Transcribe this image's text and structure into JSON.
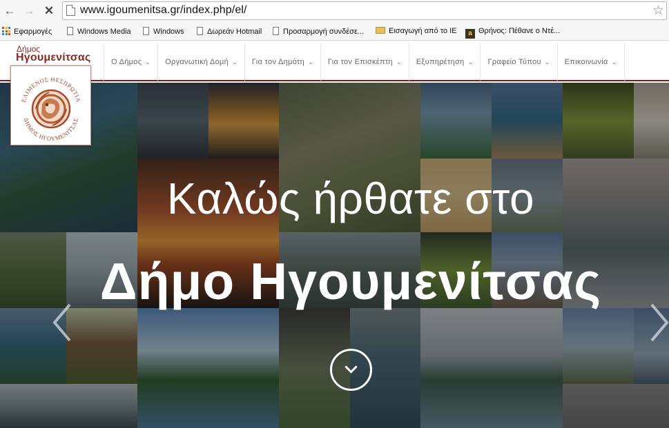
{
  "browser": {
    "url": "www.igoumenitsa.gr/index.php/el/",
    "bookmarks": [
      "Εφαρμογές",
      "Windows Media",
      "Windows",
      "Δωρεάν Hotmail",
      "Προσαρμογή συνδέσε...",
      "Εισαγωγή από το IE",
      "Θρήνος: Πέθανε ο Ντέ..."
    ],
    "bookmark_favicon_letter": "a"
  },
  "site": {
    "brand_small": "Δήμος",
    "brand_big": "Ηγουμενίτσας",
    "logo_text_top": "ΕΛΙΜΕΝΟΣ ΘΕΣΠΡΩΤΙΑ",
    "logo_text_bottom": "ΔΗΜΟΣ ΗΓΟΥΜΕΝΙΤΣΑΣ",
    "menu": [
      "Ο Δήμος",
      "Οργανωτική Δομή",
      "Για τον Δημότη",
      "Για τον Επισκέπτη",
      "Εξυπηρέτηση",
      "Γραφείο Τύπου",
      "Επικοινωνία"
    ]
  },
  "hero": {
    "welcome": "Καλώς ήρθατε στο",
    "municipality": "Δήμο Ηγουμενίτσας"
  },
  "colors": {
    "brand": "#8b2a22",
    "header_rule": "#7a1c18"
  }
}
